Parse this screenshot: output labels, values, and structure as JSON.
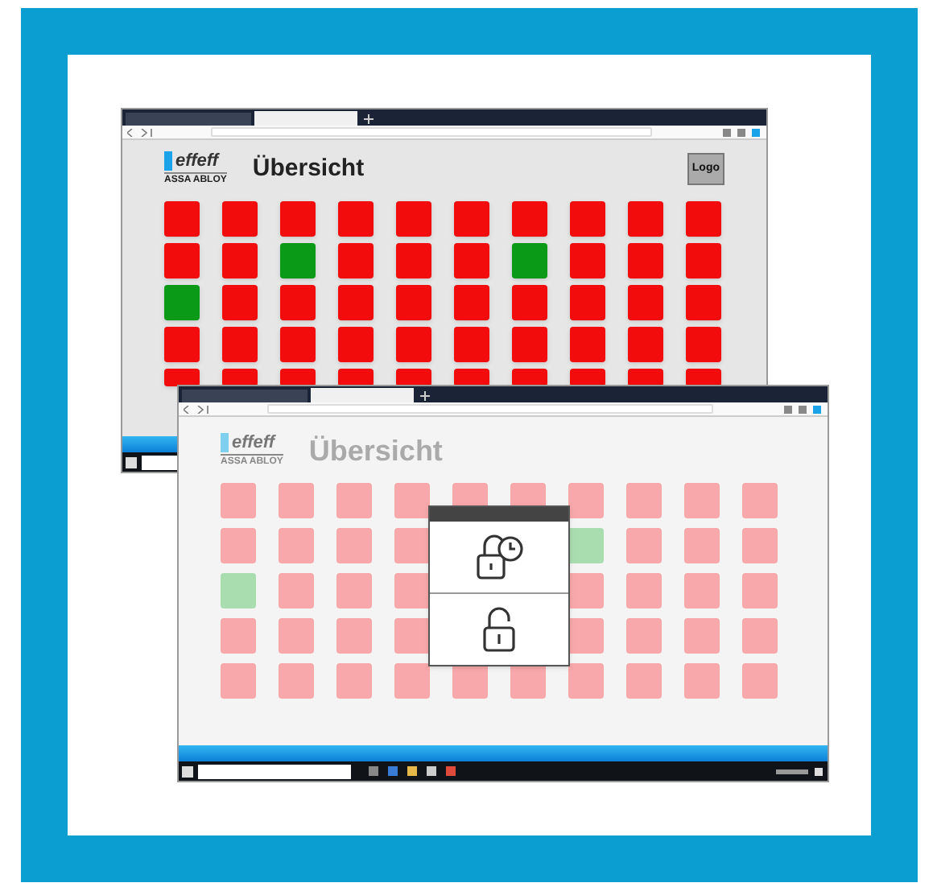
{
  "windows": [
    {
      "logo": {
        "brand": "effeff",
        "subbrand": "ASSA ABLOY"
      },
      "heading": "Übersicht",
      "logout_button": "Logo",
      "dimmed": false,
      "tiles": [
        [
          {
            "open": false
          },
          {
            "open": false
          },
          {
            "open": false
          },
          {
            "open": false
          },
          {
            "open": false
          },
          {
            "open": false
          },
          {
            "open": false
          },
          {
            "open": false
          },
          {
            "open": false
          },
          {
            "open": false
          }
        ],
        [
          {
            "open": false
          },
          {
            "open": false
          },
          {
            "open": true
          },
          {
            "open": false
          },
          {
            "open": false
          },
          {
            "open": false
          },
          {
            "open": true
          },
          {
            "open": false
          },
          {
            "open": false
          },
          {
            "open": false
          }
        ],
        [
          {
            "open": true
          },
          {
            "open": false
          },
          {
            "open": false
          },
          {
            "open": false
          },
          {
            "open": false
          },
          {
            "open": false
          },
          {
            "open": false
          },
          {
            "open": false
          },
          {
            "open": false
          },
          {
            "open": false
          }
        ],
        [
          {
            "open": false
          },
          {
            "open": false
          },
          {
            "open": false
          },
          {
            "open": false
          },
          {
            "open": false
          },
          {
            "open": false
          },
          {
            "open": false
          },
          {
            "open": false
          },
          {
            "open": false
          },
          {
            "open": false
          }
        ],
        [
          {
            "open": false
          },
          {
            "open": false
          },
          {
            "open": false
          },
          {
            "open": false
          },
          {
            "open": false
          },
          {
            "open": false
          },
          {
            "open": false
          },
          {
            "open": false
          },
          {
            "open": false
          },
          {
            "open": false
          }
        ]
      ]
    },
    {
      "logo": {
        "brand": "effeff",
        "subbrand": "ASSA ABLOY"
      },
      "heading": "Übersicht",
      "dimmed": true,
      "tiles": [
        [
          {
            "open": false
          },
          {
            "open": false
          },
          {
            "open": false
          },
          {
            "open": false
          },
          {
            "open": false
          },
          {
            "open": false
          },
          {
            "open": false
          },
          {
            "open": false
          },
          {
            "open": false
          },
          {
            "open": false
          }
        ],
        [
          {
            "open": false
          },
          {
            "open": false
          },
          {
            "open": false
          },
          {
            "open": false
          },
          {
            "open": true
          },
          {
            "open": false
          },
          {
            "open": false
          },
          {
            "open": false
          }
        ],
        [
          {
            "open": true
          },
          {
            "open": false
          },
          {
            "open": false
          },
          {
            "open": false
          },
          {
            "open": false
          },
          {
            "open": false
          },
          {
            "open": false
          },
          {
            "open": false
          }
        ],
        [
          {
            "open": false
          },
          {
            "open": false
          },
          {
            "open": false
          },
          {
            "open": false
          },
          {
            "open": false
          },
          {
            "open": false
          },
          {
            "open": false
          },
          {
            "open": false
          }
        ],
        [
          {
            "open": false
          },
          {
            "open": false
          },
          {
            "open": false
          },
          {
            "open": false
          },
          {
            "open": false
          },
          {
            "open": false
          },
          {
            "open": false
          },
          {
            "open": false
          },
          {
            "open": false
          },
          {
            "open": false
          }
        ]
      ],
      "dialog": {
        "options": [
          {
            "kind": "timed-unlock"
          },
          {
            "kind": "unlock"
          }
        ]
      }
    }
  ]
}
